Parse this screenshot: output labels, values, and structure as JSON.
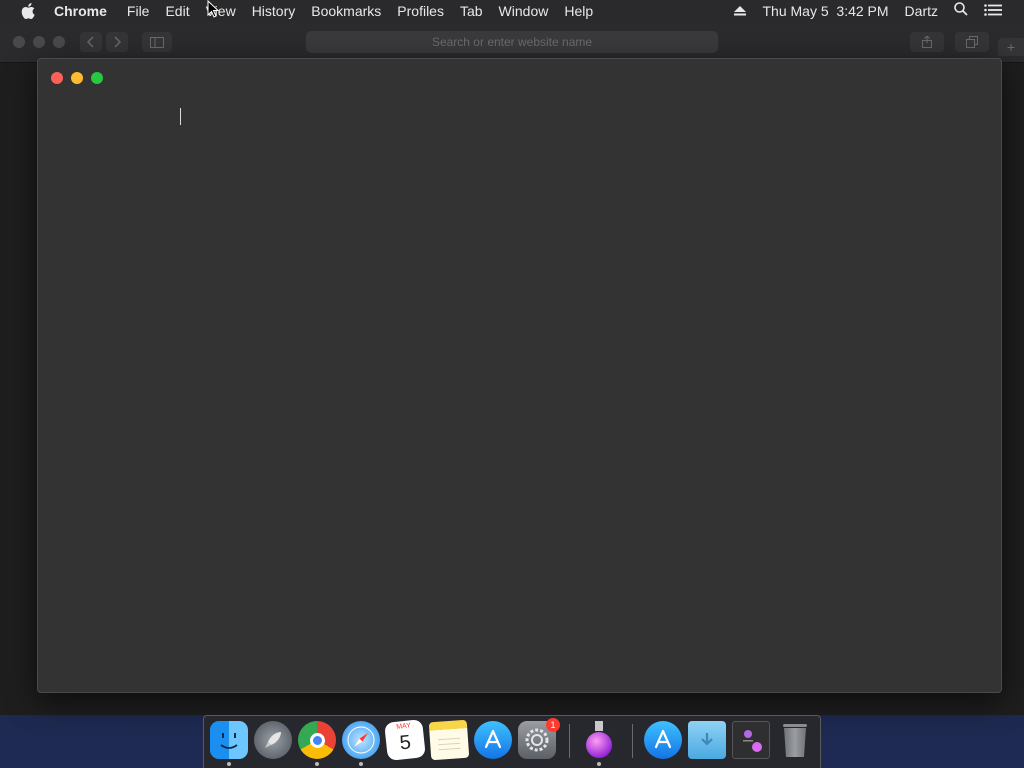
{
  "menubar": {
    "app_name": "Chrome",
    "items": [
      "File",
      "Edit",
      "View",
      "History",
      "Bookmarks",
      "Profiles",
      "Tab",
      "Window",
      "Help"
    ],
    "datetime": "Thu May 5  3:42 PM",
    "user": "Dartz"
  },
  "background_window": {
    "search_placeholder": "Search or enter website name"
  },
  "dock": {
    "calendar_month": "MAY",
    "calendar_day": "5",
    "system_prefs_badge": "1"
  },
  "colors": {
    "close": "#fe5f57",
    "minimize": "#febc2e",
    "zoom": "#28c840",
    "badge": "#ff3b30"
  },
  "icons": {
    "apple": "apple-icon",
    "eject": "eject-icon",
    "spotlight": "search-icon",
    "notification_center": "list-icon"
  }
}
